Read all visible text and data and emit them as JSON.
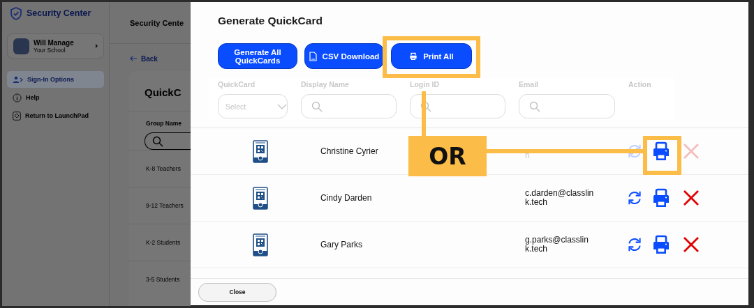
{
  "app": {
    "brand": "Security Center",
    "user": {
      "name": "Will Manage",
      "org": "Your School"
    },
    "nav": [
      {
        "label": "Sign-In Options",
        "kind": "signin",
        "selected": true
      },
      {
        "label": "Help",
        "kind": "help",
        "selected": false
      },
      {
        "label": "Return to LaunchPad",
        "kind": "launchpad",
        "selected": false
      }
    ],
    "page_title": "Security Cente",
    "back": "Back",
    "card_title": "QuickC",
    "group_column": "Group Name",
    "groups": [
      "K-8 Teachers",
      "9-12 Teachers",
      "K-2 Students",
      "3-5 Students"
    ]
  },
  "modal": {
    "title": "Generate QuickCard",
    "buttons": [
      {
        "label": "Generate All QuickCards",
        "kind": "plain"
      },
      {
        "label": "CSV Download",
        "kind": "csv"
      },
      {
        "label": "Print All",
        "kind": "print"
      }
    ],
    "columns": [
      "QuickCard",
      "Display Name",
      "Login ID",
      "Email",
      "Action"
    ],
    "filters": [
      {
        "kind": "select",
        "placeholder": "Select"
      },
      {
        "kind": "search"
      },
      {
        "kind": "search"
      },
      {
        "kind": "search"
      }
    ],
    "rows": [
      {
        "name": "Christine Cyrier",
        "email": "h",
        "dimmed": true
      },
      {
        "name": "Cindy Darden",
        "email": "c.darden@classlink.tech",
        "dimmed": false
      },
      {
        "name": "Gary Parks",
        "email": "g.parks@classlink.tech",
        "dimmed": false
      }
    ],
    "close": "Close"
  },
  "callout": {
    "label": "OR"
  }
}
